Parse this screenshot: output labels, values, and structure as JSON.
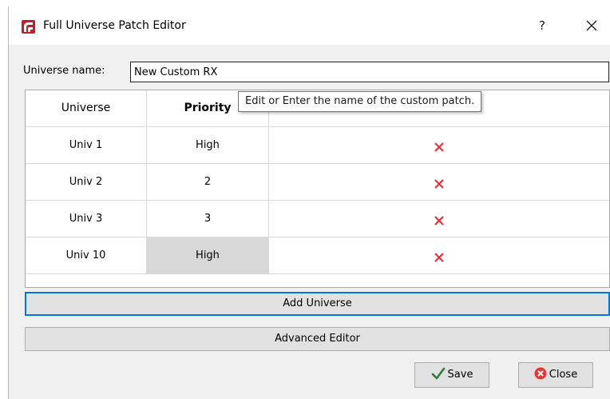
{
  "window": {
    "title": "Full Universe Patch Editor",
    "help_glyph": "?",
    "logo_icon": "app-logo-icon",
    "accent_color": "#c0202a"
  },
  "form": {
    "name_label": "Universe name:",
    "name_value": "New Custom RX"
  },
  "tooltip": {
    "text": "Edit or Enter the name of the custom patch."
  },
  "table": {
    "headers": [
      "Universe",
      "Priority",
      ""
    ],
    "rows": [
      {
        "universe": "Univ 1",
        "priority": "High",
        "action_icon": "delete-x-icon"
      },
      {
        "universe": "Univ 2",
        "priority": "2",
        "action_icon": "delete-x-icon"
      },
      {
        "universe": "Univ 3",
        "priority": "3",
        "action_icon": "delete-x-icon"
      },
      {
        "universe": "Univ 10",
        "priority": "High",
        "action_icon": "delete-x-icon",
        "selected": true
      }
    ],
    "delete_color": "#e8303a"
  },
  "buttons": {
    "add_universe": "Add Universe",
    "advanced_editor": "Advanced Editor",
    "save": "Save",
    "close": "Close",
    "focus_color": "#0078d7"
  }
}
